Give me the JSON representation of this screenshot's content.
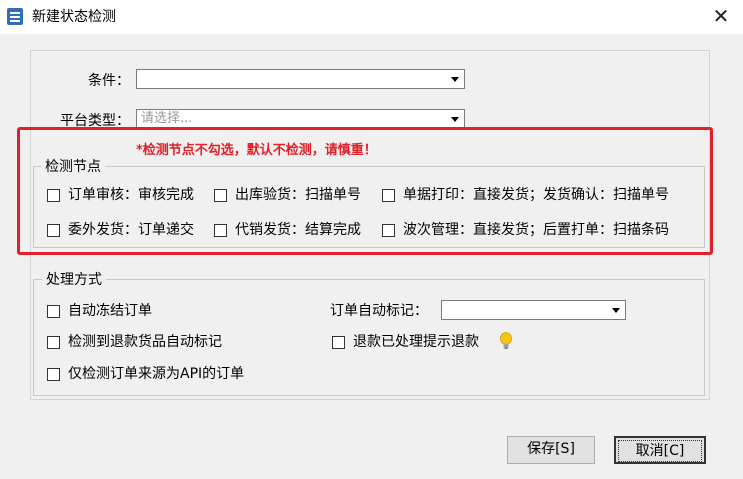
{
  "window": {
    "title": "新建状态检测",
    "close_glyph": "✕"
  },
  "form": {
    "condition_label": "条件：",
    "condition_value": "",
    "platform_label": "平台类型：",
    "platform_placeholder": "请选择..."
  },
  "detect_nodes": {
    "legend": "检测节点",
    "warning": "*检测节点不勾选，默认不检测，请慎重！",
    "items": [
      {
        "label": "订单审核：审核完成",
        "checked": false
      },
      {
        "label": "出库验货：扫描单号",
        "checked": false
      },
      {
        "label": "单据打印：直接发货；发货确认：扫描单号",
        "checked": false
      },
      {
        "label": "委外发货：订单递交",
        "checked": false
      },
      {
        "label": "代销发货：结算完成",
        "checked": false
      },
      {
        "label": "波次管理：直接发货；后置打单：扫描条码",
        "checked": false
      }
    ]
  },
  "processing": {
    "legend": "处理方式",
    "auto_freeze": "自动冻结订单",
    "detect_refund": "检测到退款货品自动标记",
    "api_only": "仅检测订单来源为API的订单",
    "auto_mark_label": "订单自动标记：",
    "auto_mark_value": "",
    "refund_prompt": "退款已处理提示退款",
    "hint_icon": "lightbulb-icon"
  },
  "buttons": {
    "save": "保存[S]",
    "cancel": "取消[C]"
  },
  "colors": {
    "highlight": "#e0202a",
    "background": "#f0f0f0"
  }
}
